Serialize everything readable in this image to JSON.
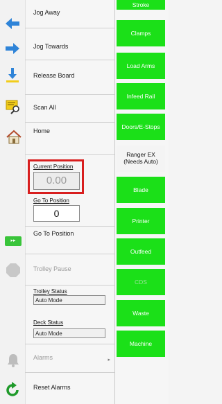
{
  "menu": {
    "jog_away": "Jog Away",
    "jog_towards": "Jog Towards",
    "release_board": "Release Board",
    "scan_all": "Scan All",
    "home": "Home",
    "go_to_position_button": "Go To Position",
    "trolley_pause": "Trolley Pause",
    "alarms": "Alarms",
    "reset_alarms": "Reset Alarms"
  },
  "current_position": {
    "label": "Current Position",
    "value": "0.00"
  },
  "go_to_position": {
    "label": "Go To Position",
    "value": "0"
  },
  "trolley_status": {
    "label": "Trolley Status",
    "value": "Auto Mode"
  },
  "deck_status": {
    "label": "Deck Status",
    "value": "Auto Mode"
  },
  "side_buttons": {
    "stroke": "Stroke",
    "clamps": "Clamps",
    "load_arms": "Load Arms",
    "infeed_rail": "Infeed Rail",
    "doors_estops": "Doors/E-Stops",
    "ranger_ex_line1": "Ranger EX",
    "ranger_ex_line2": "(Needs Auto)",
    "blade": "Blade",
    "printer": "Printer",
    "outfeed": "Outfeed",
    "cds": "CDS",
    "waste": "Waste",
    "machine": "Machine"
  },
  "colors": {
    "accent_green": "#1be018",
    "highlight_red": "#d81e1e",
    "arrow_blue": "#2f84d8"
  }
}
